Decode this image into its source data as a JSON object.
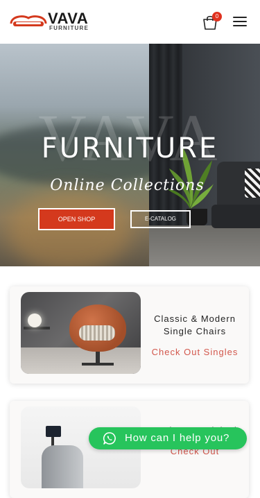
{
  "header": {
    "logo_text": "VAVA",
    "logo_subtext": "FURNITURE",
    "cart_count": "0",
    "icons": [
      "logo-icon",
      "shopping-bag-icon",
      "hamburger-menu-icon"
    ]
  },
  "hero": {
    "watermark": "VAVA",
    "title": "FURNITURE",
    "subtitle": "Online Collections",
    "primary_button": "OPEN SHOP",
    "secondary_button": "E-CATALOG"
  },
  "products": [
    {
      "title": "Classic & Modern Single Chairs",
      "link": "Check Out Singles"
    },
    {
      "title": "Modern & Original",
      "link": "Check Out"
    }
  ],
  "chat": {
    "label": "How can I help you?",
    "icon": "whatsapp-icon"
  },
  "colors": {
    "brand_red": "#d4391d",
    "link_red": "#d2574c",
    "whatsapp_green": "#27c45c",
    "badge_red": "#e0311f"
  }
}
